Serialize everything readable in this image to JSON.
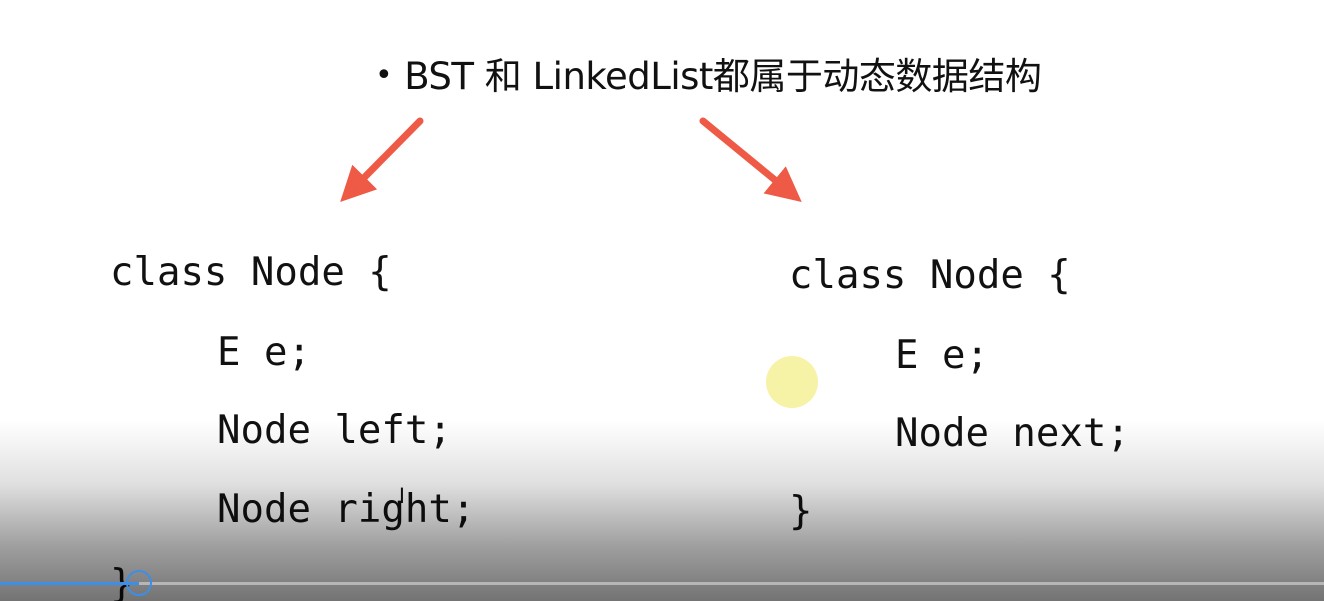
{
  "slide": {
    "bullet": "•",
    "title": "BST 和 LinkedList都属于动态数据结构"
  },
  "bst_code": {
    "line1": "class Node {",
    "line2": "E e;",
    "line3": "Node left;",
    "line4": "Node right;",
    "line5": "}"
  },
  "linkedlist_code": {
    "line1": "class Node {",
    "line2": "E e;",
    "line3": "Node next;",
    "line4": "}"
  },
  "colors": {
    "arrow": "#ef5a46",
    "progress": "#3d8ee8",
    "cursor_highlight": "#f5f096"
  },
  "player": {
    "progress_fraction": 0.105
  }
}
